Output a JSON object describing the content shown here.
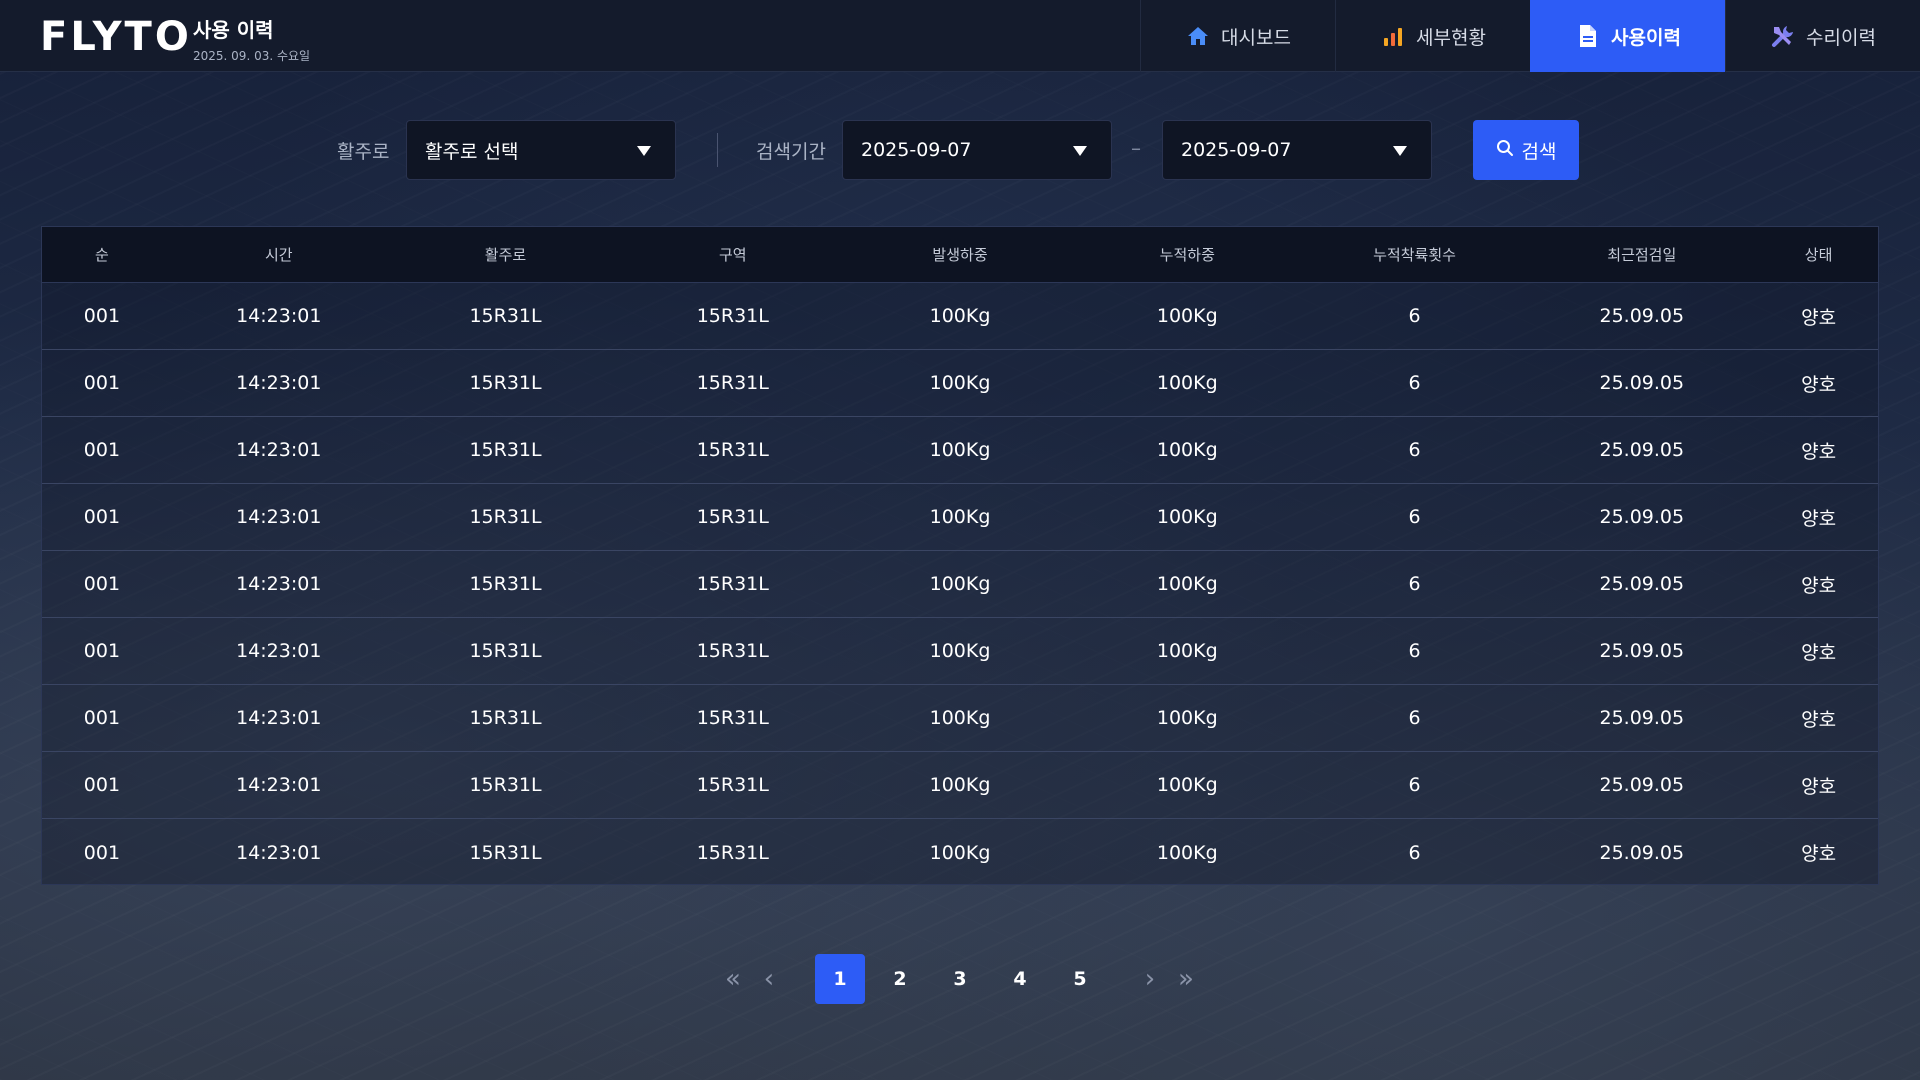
{
  "header": {
    "logo": "FLYTO",
    "page_title": "사용 이력",
    "date": "2025. 09. 03. 수요일",
    "nav": [
      {
        "label": "대시보드",
        "icon": "home-icon",
        "active": false
      },
      {
        "label": "세부현황",
        "icon": "bar-chart-icon",
        "active": false
      },
      {
        "label": "사용이력",
        "icon": "document-icon",
        "active": true
      },
      {
        "label": "수리이력",
        "icon": "tools-icon",
        "active": false
      }
    ]
  },
  "filters": {
    "runway_label": "활주로",
    "runway_value": "활주로 선택",
    "period_label": "검색기간",
    "start_date": "2025-09-07",
    "separator": "–",
    "end_date": "2025-09-07",
    "search_label": "검색"
  },
  "table": {
    "headers": [
      "순",
      "시간",
      "활주로",
      "구역",
      "발생하중",
      "누적하중",
      "누적착륙횟수",
      "최근점검일",
      "상태"
    ],
    "rows": [
      [
        "001",
        "14:23:01",
        "15R31L",
        "15R31L",
        "100Kg",
        "100Kg",
        "6",
        "25.09.05",
        "양호"
      ],
      [
        "001",
        "14:23:01",
        "15R31L",
        "15R31L",
        "100Kg",
        "100Kg",
        "6",
        "25.09.05",
        "양호"
      ],
      [
        "001",
        "14:23:01",
        "15R31L",
        "15R31L",
        "100Kg",
        "100Kg",
        "6",
        "25.09.05",
        "양호"
      ],
      [
        "001",
        "14:23:01",
        "15R31L",
        "15R31L",
        "100Kg",
        "100Kg",
        "6",
        "25.09.05",
        "양호"
      ],
      [
        "001",
        "14:23:01",
        "15R31L",
        "15R31L",
        "100Kg",
        "100Kg",
        "6",
        "25.09.05",
        "양호"
      ],
      [
        "001",
        "14:23:01",
        "15R31L",
        "15R31L",
        "100Kg",
        "100Kg",
        "6",
        "25.09.05",
        "양호"
      ],
      [
        "001",
        "14:23:01",
        "15R31L",
        "15R31L",
        "100Kg",
        "100Kg",
        "6",
        "25.09.05",
        "양호"
      ],
      [
        "001",
        "14:23:01",
        "15R31L",
        "15R31L",
        "100Kg",
        "100Kg",
        "6",
        "25.09.05",
        "양호"
      ],
      [
        "001",
        "14:23:01",
        "15R31L",
        "15R31L",
        "100Kg",
        "100Kg",
        "6",
        "25.09.05",
        "양호"
      ]
    ]
  },
  "pagination": {
    "first": "«",
    "prev": "‹",
    "pages": [
      "1",
      "2",
      "3",
      "4",
      "5"
    ],
    "current_page": "1",
    "next": "›",
    "last": "»"
  },
  "colors": {
    "accent": "#2d5cf6",
    "header_bg": "#141b2c",
    "input_bg": "#0f1524"
  }
}
